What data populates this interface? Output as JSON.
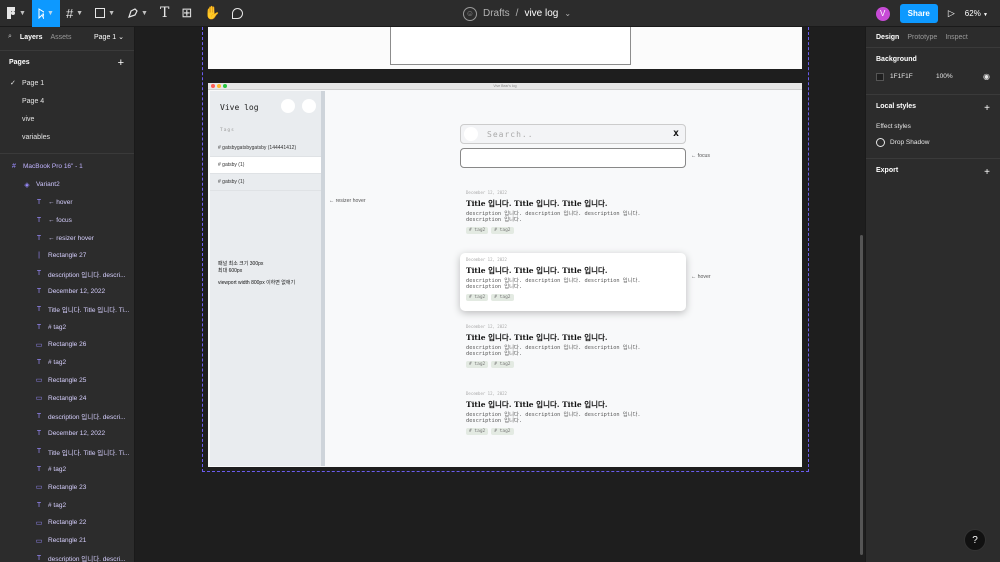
{
  "toolbar": {
    "move_tool_icon": "cursor-arrow",
    "crumb": "Drafts",
    "separator": "/",
    "file_name": "vive log",
    "file_caret": "⌄",
    "user_initial": "V",
    "share_label": "Share",
    "play_icon": "▷",
    "zoom": "62%"
  },
  "left": {
    "tab_layers": "Layers",
    "tab_assets": "Assets",
    "page_picker": "Page 1 ⌄",
    "pages_heading": "Pages",
    "add": "+",
    "pages": [
      "Page 1",
      "Page 4",
      "vive",
      "variables"
    ],
    "layers": [
      {
        "icon": "#",
        "text": "MacBook Pro 16\" - 1",
        "level": 0
      },
      {
        "icon": "◈",
        "text": "Variant2",
        "level": 1
      },
      {
        "icon": "T",
        "text": "← hover",
        "level": 2
      },
      {
        "icon": "T",
        "text": "← focus",
        "level": 2
      },
      {
        "icon": "T",
        "text": "← resizer hover",
        "level": 2
      },
      {
        "icon": "|",
        "text": "Rectangle 27",
        "level": 2
      },
      {
        "icon": "T",
        "text": "description 입니다. descri...",
        "level": 2
      },
      {
        "icon": "T",
        "text": "December 12, 2022",
        "level": 2
      },
      {
        "icon": "T",
        "text": "Title 입니다. Title 입니다. Ti...",
        "level": 2
      },
      {
        "icon": "T",
        "text": "# tag2",
        "level": 2
      },
      {
        "icon": "▭",
        "text": "Rectangle 26",
        "level": 2
      },
      {
        "icon": "T",
        "text": "# tag2",
        "level": 2
      },
      {
        "icon": "▭",
        "text": "Rectangle 25",
        "level": 2
      },
      {
        "icon": "▭",
        "text": "Rectangle 24",
        "level": 2
      },
      {
        "icon": "T",
        "text": "description 입니다. descri...",
        "level": 2
      },
      {
        "icon": "T",
        "text": "December 12, 2022",
        "level": 2
      },
      {
        "icon": "T",
        "text": "Title 입니다. Title 입니다. Ti...",
        "level": 2
      },
      {
        "icon": "T",
        "text": "# tag2",
        "level": 2
      },
      {
        "icon": "▭",
        "text": "Rectangle 23",
        "level": 2
      },
      {
        "icon": "T",
        "text": "# tag2",
        "level": 2
      },
      {
        "icon": "▭",
        "text": "Rectangle 22",
        "level": 2
      },
      {
        "icon": "▭",
        "text": "Rectangle 21",
        "level": 2
      },
      {
        "icon": "T",
        "text": "description 입니다. descri...",
        "level": 2
      }
    ]
  },
  "app": {
    "window_title": "Vive Bear's log",
    "logo": "Vive log",
    "tags_heading": "Tags",
    "tags": [
      "# gatsbygatsbygatsby (144441412)",
      "# gatsby (1)",
      "# gatsby (1)"
    ],
    "note1_line1": "패널 최소 크기 300px",
    "note1_line2": "최대 600px",
    "note2": "viewport width 800px 이하면 없애기",
    "annot_resizer": "← resizer hover",
    "annot_focus": "← focus",
    "annot_hover": "← hover",
    "search_placeholder": "Search..",
    "search_clear": "x",
    "posts": [
      {
        "date": "December 12, 2022",
        "title": "Title 입니다. Title 입니다. Title 입니다.",
        "desc1": "description 입니다. description 입니다. description 입니다.",
        "desc2": "description 입니다.",
        "tags": [
          "# tag2",
          "# tag2"
        ]
      },
      {
        "date": "December 12, 2022",
        "title": "Title 입니다. Title 입니다. Title 입니다.",
        "desc1": "description 입니다. description 입니다. description 입니다.",
        "desc2": "description 입니다.",
        "tags": [
          "# tag2",
          "# tag2"
        ]
      },
      {
        "date": "December 12, 2022",
        "title": "Title 입니다. Title 입니다. Title 입니다.",
        "desc1": "description 입니다. description 입니다. description 입니다.",
        "desc2": "description 입니다.",
        "tags": [
          "# tag2",
          "# tag2"
        ]
      },
      {
        "date": "December 12, 2022",
        "title": "Title 입니다. Title 입니다. Title 입니다.",
        "desc1": "description 입니다. description 입니다. description 입니다.",
        "desc2": "description 입니다.",
        "tags": [
          "# tag2",
          "# tag2"
        ]
      }
    ]
  },
  "right": {
    "tab_design": "Design",
    "tab_prototype": "Prototype",
    "tab_inspect": "Inspect",
    "background_heading": "Background",
    "bg_hex": "1F1F1F",
    "bg_opacity": "100%",
    "local_styles": "Local styles",
    "effect_styles": "Effect styles",
    "drop_shadow": "Drop Shadow",
    "export": "Export",
    "add": "+",
    "help": "?"
  },
  "colors": {
    "accent": "#0d99ff",
    "selection": "#6a5cf0",
    "panel": "#2c2c2c",
    "canvas": "#1e1e1e"
  }
}
